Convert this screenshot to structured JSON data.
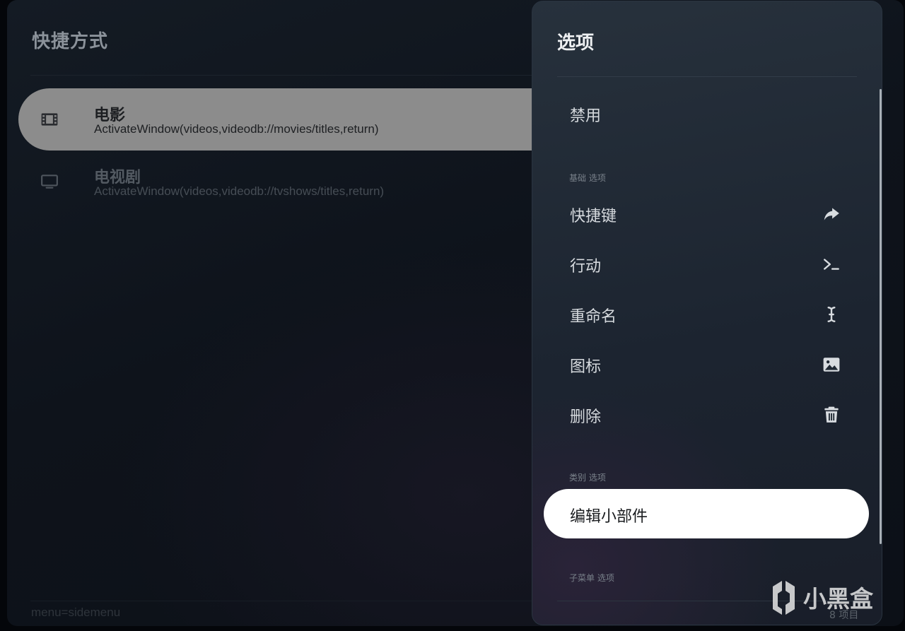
{
  "left": {
    "title": "快捷方式",
    "items": [
      {
        "label": "电影",
        "path": "ActivateWindow(videos,videodb://movies/titles,return)",
        "icon": "film-icon",
        "selected": true
      },
      {
        "label": "电视剧",
        "path": "ActivateWindow(videos,videodb://tvshows/titles,return)",
        "icon": "monitor-icon",
        "selected": false
      }
    ],
    "footer": "menu=sidemenu"
  },
  "panel": {
    "title": "选项",
    "disable_label": "禁用",
    "group_basic": "基础 选项",
    "basic_items": [
      {
        "label": "快捷键",
        "icon": "share-arrow-icon"
      },
      {
        "label": "行动",
        "icon": "terminal-icon"
      },
      {
        "label": "重命名",
        "icon": "text-cursor-icon"
      },
      {
        "label": "图标",
        "icon": "image-icon"
      },
      {
        "label": "删除",
        "icon": "trash-icon"
      }
    ],
    "group_category": "类别 选项",
    "category_items": [
      {
        "label": "编辑小部件",
        "focused": true
      }
    ],
    "group_submenu": "子菜单 选项",
    "count": "8 项目"
  },
  "colors": {
    "selected_row": "#8c8c8c",
    "focused_pill": "#ffffff",
    "panel_bg": "#1f2833",
    "background": "#0e131b"
  },
  "watermark": {
    "text": "小黑盒",
    "icon": "xiaoheihe-logo-icon"
  }
}
